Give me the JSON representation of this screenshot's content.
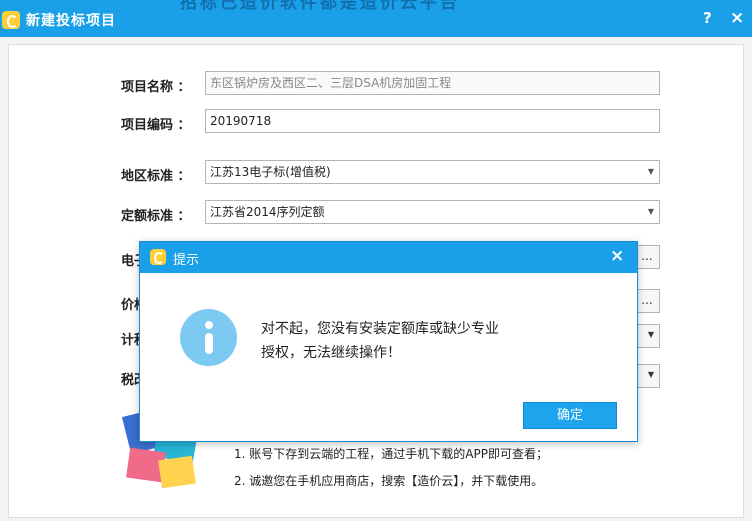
{
  "window": {
    "title": "新建投标项目",
    "help_label": "?",
    "close_label": "×",
    "ghost_text": "招标已造价软件都是造价云平台"
  },
  "form": {
    "project_name": {
      "label": "项目名称 ：",
      "value": "东区锅炉房及西区二、三层DSA机房加固工程"
    },
    "project_code": {
      "label": "项目编码 ：",
      "value": "20190718"
    },
    "region_standard": {
      "label": "地区标准 ：",
      "value": "江苏13电子标(增值税)"
    },
    "quota_standard": {
      "label": "定额标准 ：",
      "value": "江苏省2014序列定额"
    },
    "cut_labels": [
      "电子",
      "价格",
      "计税",
      "税改"
    ],
    "browse_label": "..."
  },
  "notes": [
    "1.  账号下存到云端的工程，通过手机下载的APP即可查看；",
    "2.  诚邀您在手机应用商店，搜索【造价云】，并下载使用。"
  ],
  "dialog": {
    "title": "提示",
    "close_label": "×",
    "message": "对不起，您没有安装定额库或缺少专业授权，无法继续操作！",
    "ok_label": "确定"
  }
}
